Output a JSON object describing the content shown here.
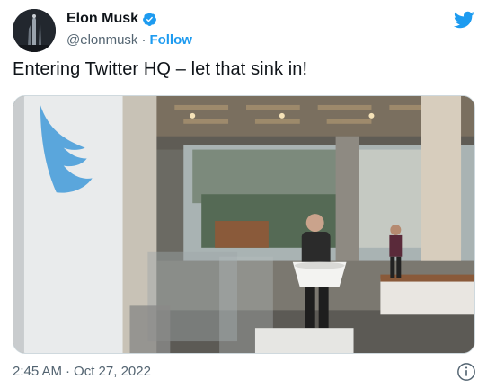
{
  "author": {
    "display_name": "Elon Musk",
    "handle": "@elonmusk",
    "follow_label": "Follow",
    "verified": true
  },
  "tweet": {
    "text": "Entering Twitter HQ – let that sink in!",
    "time": "2:45 AM",
    "date": "Oct 27, 2022"
  },
  "media": {
    "description_icon": "photo",
    "sign_icon": "twitter-bird-logo"
  },
  "colors": {
    "accent": "#1d9bf0",
    "text": "#0f1419",
    "secondary_text": "#536471",
    "border": "#cfd9de"
  },
  "icons": {
    "verified": "verified-badge-icon",
    "brand": "twitter-bird-icon",
    "info": "info-icon"
  }
}
